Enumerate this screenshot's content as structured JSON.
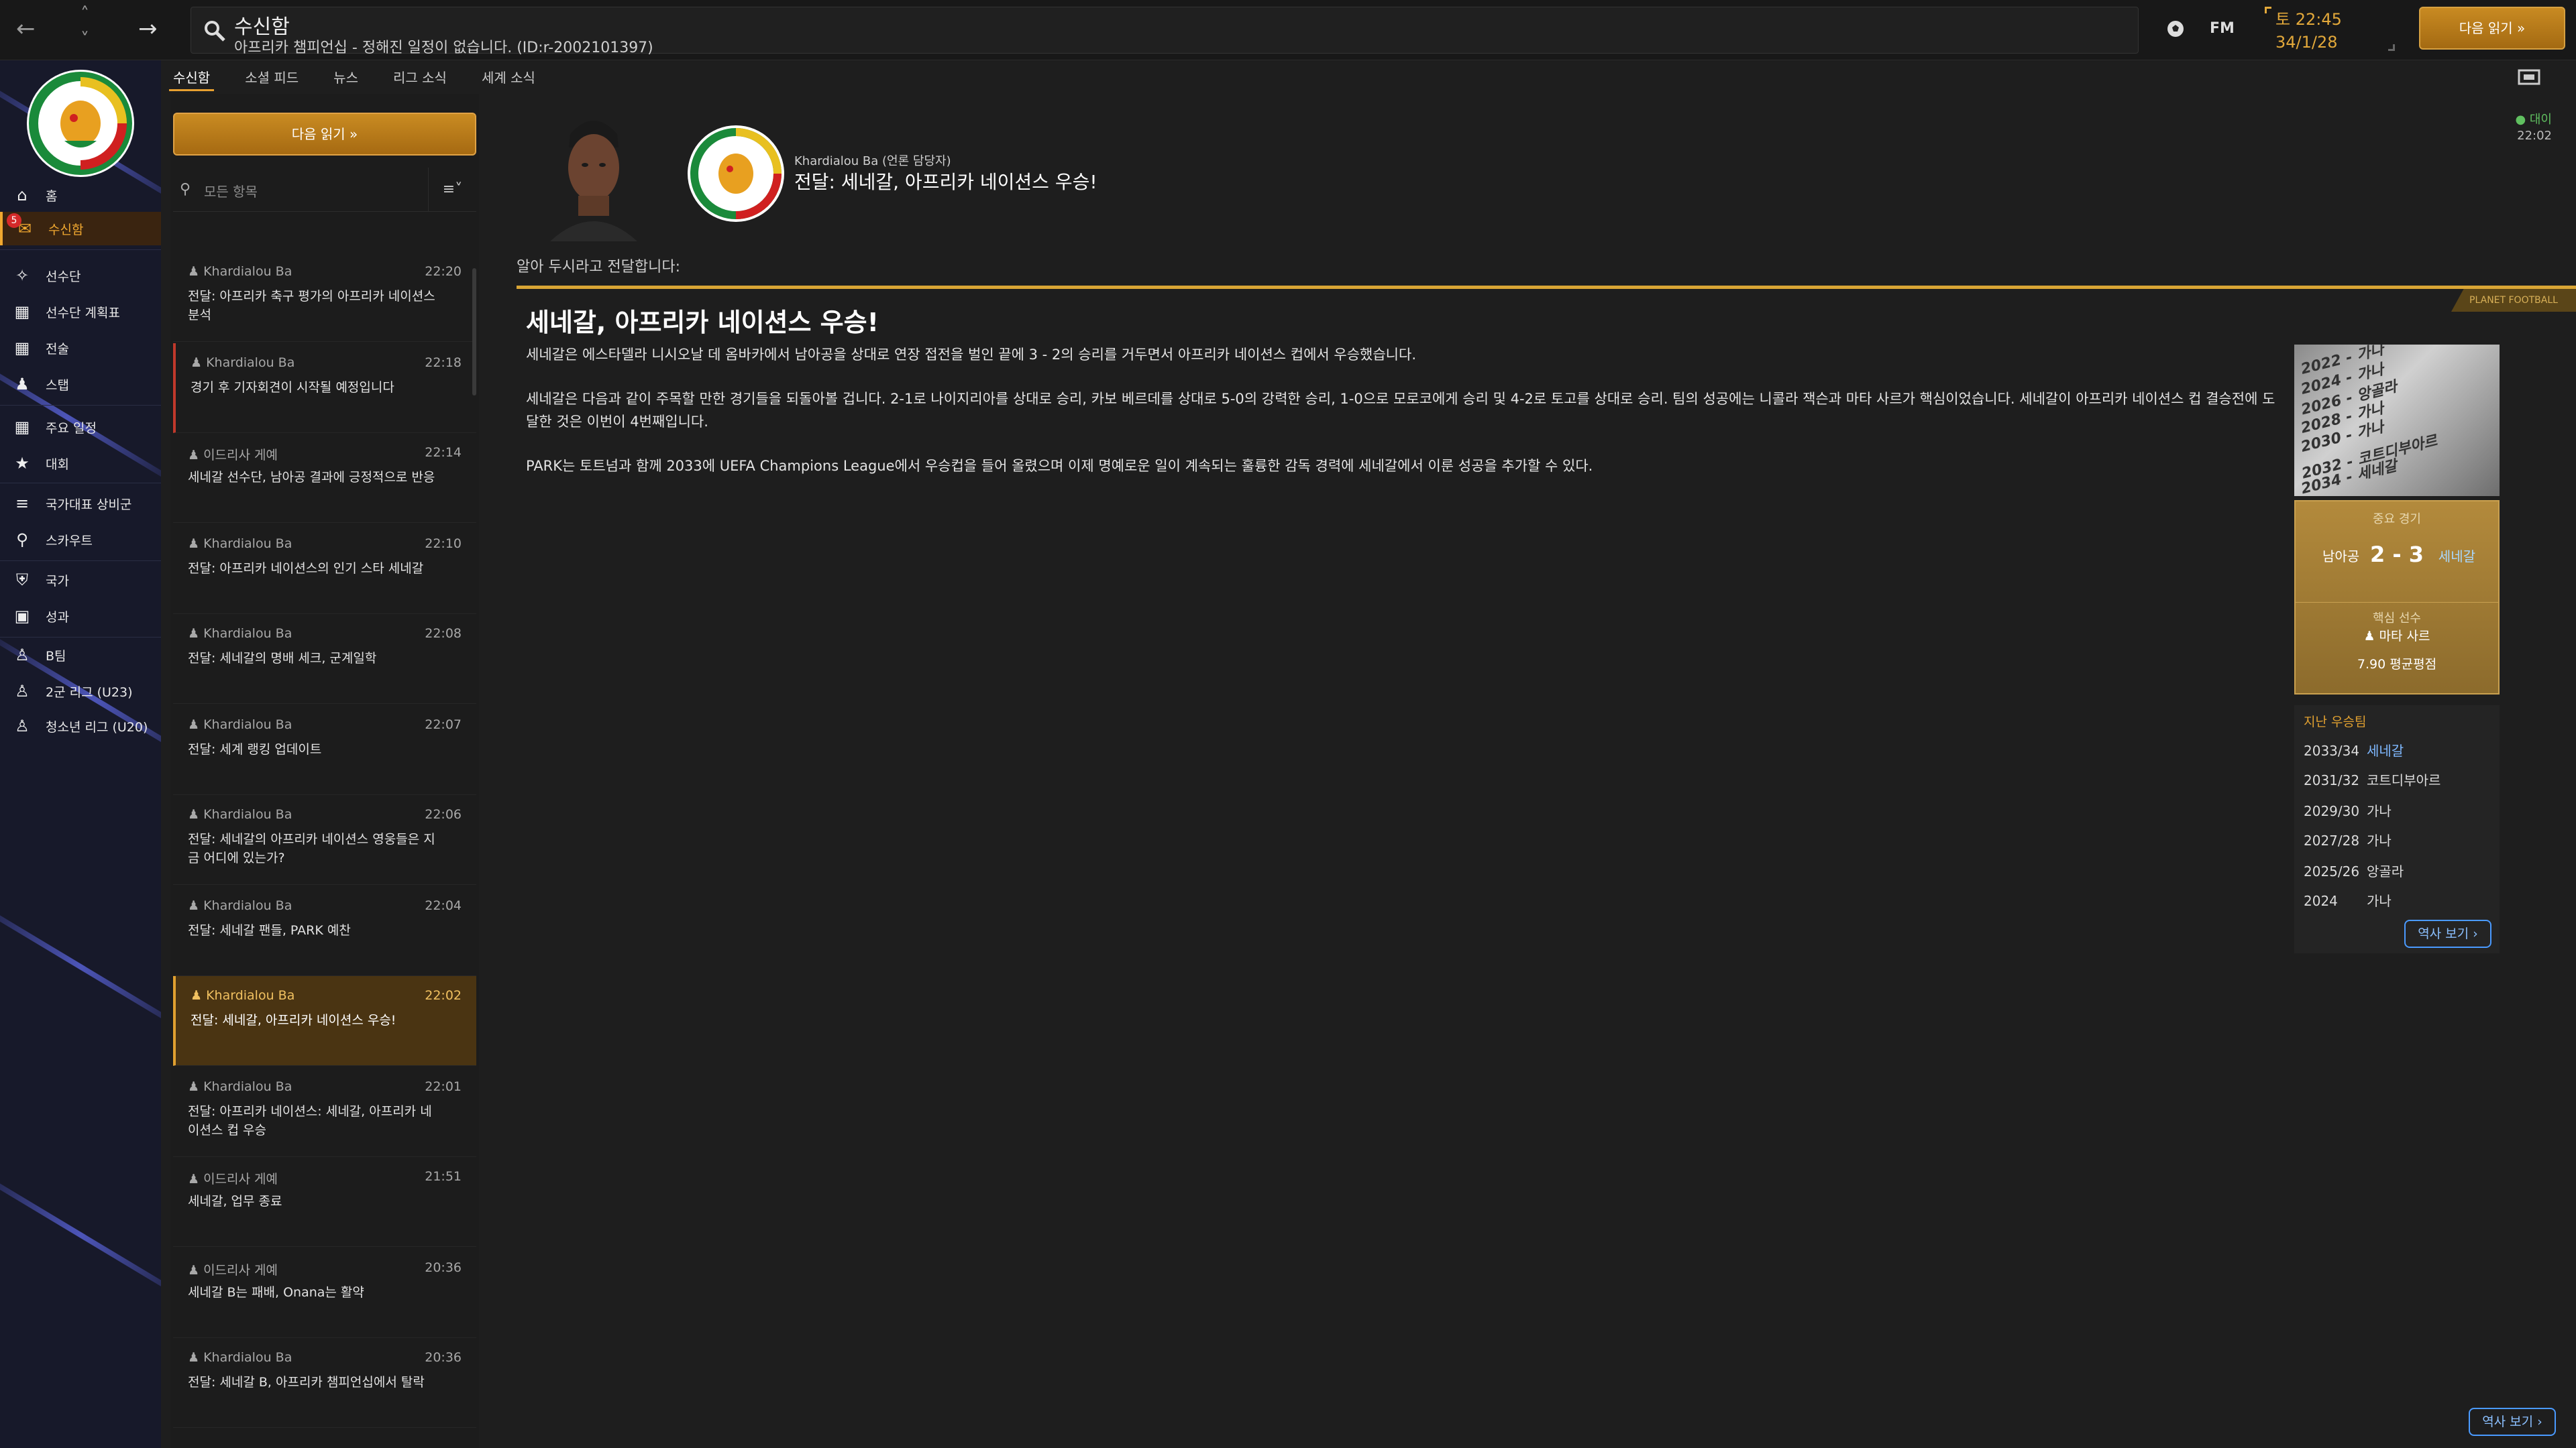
{
  "topbar": {
    "search_title": "수신함",
    "search_subtitle": "아프리카 챔피언십 - 정해진 일정이 없습니다. (ID:r-2002101397)",
    "fm_label": "FM",
    "clock_day_time": "토 22:45",
    "clock_date": "34/1/28",
    "continue_label": "다음 읽기 »"
  },
  "sidebar": {
    "badge": "5",
    "items": [
      {
        "label": "홈",
        "icon": "home-icon"
      },
      {
        "label": "수신함",
        "icon": "inbox-icon"
      },
      {
        "label": "선수단",
        "icon": "shirt-icon"
      },
      {
        "label": "선수단 계획표",
        "icon": "clipboard-icon"
      },
      {
        "label": "전술",
        "icon": "tactics-icon"
      },
      {
        "label": "스탭",
        "icon": "staff-icon"
      },
      {
        "label": "주요 일정",
        "icon": "calendar-icon"
      },
      {
        "label": "대회",
        "icon": "trophy-icon"
      },
      {
        "label": "국가대표 상비군",
        "icon": "list-icon"
      },
      {
        "label": "스카우트",
        "icon": "scout-icon"
      },
      {
        "label": "국가",
        "icon": "nation-icon"
      },
      {
        "label": "성과",
        "icon": "briefcase-icon"
      },
      {
        "label": "B팀",
        "icon": "team-icon"
      },
      {
        "label": "2군 리그 (U23)",
        "icon": "team-icon"
      },
      {
        "label": "청소년 리그 (U20)",
        "icon": "team-icon"
      }
    ]
  },
  "tabs": [
    "수신함",
    "소셜 피드",
    "뉴스",
    "리그 소식",
    "세계 소식"
  ],
  "list": {
    "continue_label": "다음 읽기 »",
    "search_placeholder": "모든 항목",
    "messages": [
      {
        "sender": "Khardialou Ba",
        "time": "22:20",
        "subject": "전달: 아프리카 축구 평가의 아프리카 네이션스 분석"
      },
      {
        "sender": "Khardialou Ba",
        "time": "22:18",
        "subject": "경기 후 기자회견이 시작될 예정입니다"
      },
      {
        "sender": "이드리사 게예",
        "time": "22:14",
        "subject": "세네갈 선수단, 남아공 결과에 긍정적으로 반응"
      },
      {
        "sender": "Khardialou Ba",
        "time": "22:10",
        "subject": "전달: 아프리카 네이션스의 인기 스타 세네갈"
      },
      {
        "sender": "Khardialou Ba",
        "time": "22:08",
        "subject": "전달: 세네갈의 명배 세크, 군계일학"
      },
      {
        "sender": "Khardialou Ba",
        "time": "22:07",
        "subject": "전달: 세계 랭킹 업데이트"
      },
      {
        "sender": "Khardialou Ba",
        "time": "22:06",
        "subject": "전달: 세네갈의 아프리카 네이션스 영웅들은 지금 어디에 있는가?"
      },
      {
        "sender": "Khardialou Ba",
        "time": "22:04",
        "subject": "전달: 세네갈 팬들, PARK 예찬"
      },
      {
        "sender": "Khardialou Ba",
        "time": "22:02",
        "subject": "전달: 세네갈, 아프리카 네이션스 우승!"
      },
      {
        "sender": "Khardialou Ba",
        "time": "22:01",
        "subject": "전달: 아프리카 네이션스: 세네갈, 아프리카 네이션스 컵 우승"
      },
      {
        "sender": "이드리사 게예",
        "time": "21:51",
        "subject": "세네갈, 업무 종료"
      },
      {
        "sender": "이드리사 게예",
        "time": "20:36",
        "subject": "세네갈 B는 패배, Onana는 활약"
      },
      {
        "sender": "Khardialou Ba",
        "time": "20:36",
        "subject": "전달: 세네갈 B, 아프리카 챔피언십에서 탈락"
      }
    ]
  },
  "article": {
    "from": "Khardialou Ba (언론 담당자)",
    "header_title": "전달: 세네갈, 아프리카 네이션스 우승!",
    "unread_label": "대이",
    "time": "22:02",
    "intro": "알아 두시라고 전달합니다:",
    "source": "PLANET FOOTBALL",
    "title": "세네갈, 아프리카 네이션스 우승!",
    "paragraphs": [
      "세네갈은 에스타델라 니시오날 데 옴바카에서 남아공을 상대로 연장 접전을 벌인 끝에 3 - 2의 승리를 거두면서 아프리카 네이션스 컵에서 우승했습니다.",
      "세네갈은 다음과 같이 주목할 만한 경기들을 되돌아볼 겁니다. 2-1로 나이지리아를 상대로 승리, 카보 베르데를 상대로 5-0의 강력한 승리, 1-0으로 모로코에게 승리 및 4-2로 토고를 상대로 승리. 팀의 성공에는 니콜라 잭슨과 마타 사르가 핵심이었습니다. 세네갈이 아프리카 네이션스 컵 결승전에 도달한 것은 이번이 4번째입니다.",
      "PARK는 토트넘과 함께 2033에 UEFA Champions League에서 우승컵을 들어 올렸으며 이제 명예로운 일이 계속되는 훌륭한 감독 경력에 세네갈에서 이룬 성공을 추가할 수 있다."
    ]
  },
  "photo_words": [
    "2022 - 가나",
    "2024 - 가나",
    "2026 - 앙골라",
    "2028 - 가나",
    "2030 - 가나",
    "2032 - 코트디부아르",
    "2034 - 세네갈"
  ],
  "key_match": {
    "label": "중요 경기",
    "home": "남아공",
    "score": "2 - 3",
    "away": "세네갈",
    "player_label": "핵심 선수",
    "player": "마타 사르",
    "rating": "7.90 평균평점"
  },
  "winners": {
    "title": "지난 우승팀",
    "rows": [
      {
        "year": "2033/34",
        "team": "세네갈",
        "link": true
      },
      {
        "year": "2031/32",
        "team": "코트디부아르",
        "link": false
      },
      {
        "year": "2029/30",
        "team": "가나",
        "link": false
      },
      {
        "year": "2027/28",
        "team": "가나",
        "link": false
      },
      {
        "year": "2025/26",
        "team": "앙골라",
        "link": false
      },
      {
        "year": "2024",
        "team": "가나",
        "link": false
      }
    ],
    "history_label": "역사 보기 ›"
  },
  "footer_history_label": "역사 보기 ›",
  "colors": {
    "accent": "#e0a030",
    "sidebar_bg": "#17192a",
    "link": "#7fb8ff"
  }
}
